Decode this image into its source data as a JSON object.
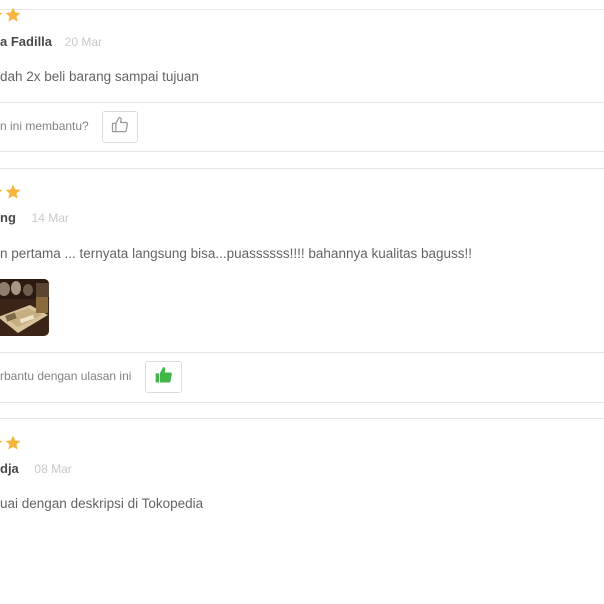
{
  "colors": {
    "star": "#f7b53b",
    "thumb_active": "#42b549",
    "thumb_inactive": "#999999",
    "date": "#c9c9c9",
    "divider": "#e5e5e5"
  },
  "reviews": [
    {
      "name": "a Fadilla",
      "date": "20 Mar",
      "text": "dah 2x beli barang sampai tujuan",
      "helpful_text": "n ini membantu?",
      "helpful_icon": "thumbs-up-outline-icon",
      "liked": false
    },
    {
      "name": "ng",
      "date": "14 Mar",
      "text": "n pertama ... ternyata langsung bisa...puassssss!!!! bahannya kualitas baguss!!",
      "helpful_text": "rbantu dengan ulasan ini",
      "helpful_icon": "thumbs-up-filled-icon",
      "liked": true
    },
    {
      "name": "dja",
      "date": "08 Mar",
      "text": "uai dengan deskripsi di Tokopedia"
    }
  ]
}
